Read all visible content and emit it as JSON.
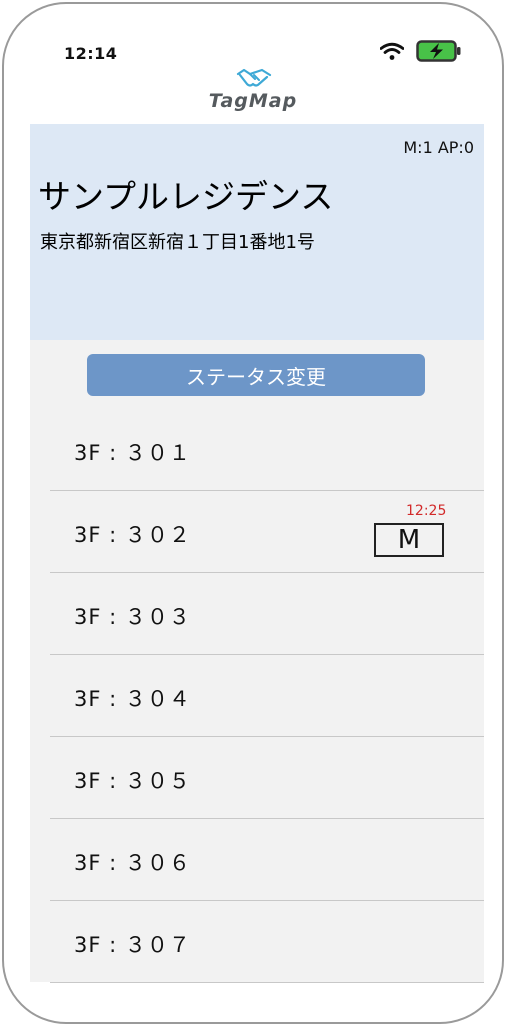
{
  "status_bar": {
    "time": "12:14"
  },
  "brand": {
    "name": "TagMap"
  },
  "property": {
    "counts": "M:1 AP:0",
    "name": "サンプルレジデンス",
    "address": "東京都新宿区新宿１丁目1番地1号"
  },
  "actions": {
    "status_button_label": "ステータス変更"
  },
  "units": [
    {
      "label": "3F : ３０１"
    },
    {
      "label": "3F : ３０２",
      "time": "12:25",
      "badge": "M"
    },
    {
      "label": "3F : ３０３"
    },
    {
      "label": "3F : ３０４"
    },
    {
      "label": "3F : ３０５"
    },
    {
      "label": "3F : ３０６"
    },
    {
      "label": "3F : ３０７"
    }
  ],
  "colors": {
    "card_background": "#dde8f5",
    "button_background": "#6d96c8",
    "time_text": "#d22a2a",
    "battery_fill": "#48c248",
    "brand_icon": "#3ea9d6"
  },
  "icons": [
    "wifi-icon",
    "battery-charging-icon",
    "handshake-icon"
  ]
}
